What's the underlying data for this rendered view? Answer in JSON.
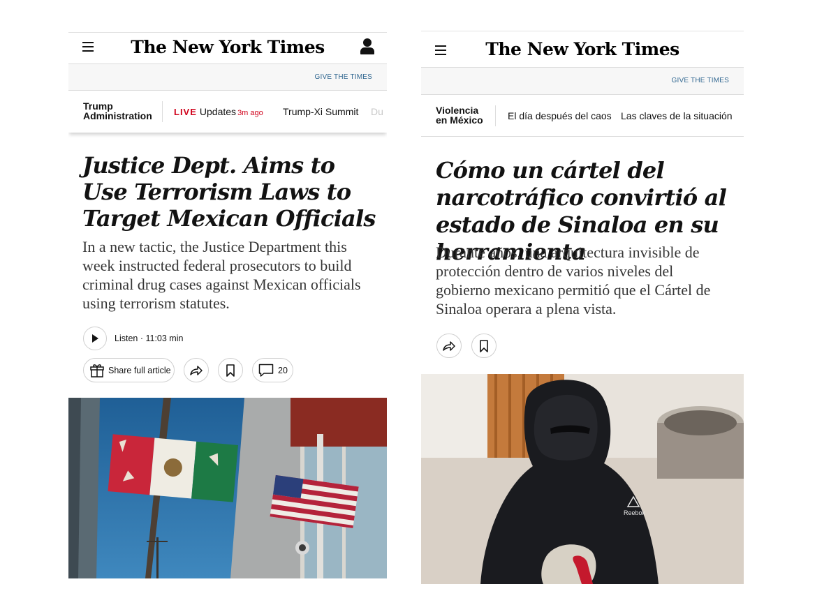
{
  "left": {
    "masthead": {
      "logo": "The New York Times",
      "menu_icon": "hamburger-icon",
      "account_icon": "user-icon"
    },
    "give_link": "GIVE THE TIMES",
    "nav": {
      "section": [
        "Trump",
        "Administration"
      ],
      "live": "LIVE",
      "updates": "Updates",
      "ago": "3m ago",
      "item2": "Trump-Xi Summit",
      "item3": "Du"
    },
    "headline": "Justice Dept. Aims to Use Terrorism Laws to Target Mexican Officials",
    "summary": "In a new tactic, the Justice Department this week instructed federal prosecutors to build criminal drug cases against Mexican officials using terrorism statutes.",
    "listen": "Listen · 11:03 min",
    "share_label": "Share full article",
    "comments_count": "20",
    "icons": [
      "play-icon",
      "gift-icon",
      "share-icon",
      "bookmark-icon",
      "comment-icon"
    ]
  },
  "right": {
    "masthead": {
      "logo": "The New York Times",
      "menu_icon": "hamburger-icon"
    },
    "give_link": "GIVE THE TIMES",
    "nav": {
      "section": [
        "Violencia",
        "en México"
      ],
      "item1": "El día después del caos",
      "item2": "Las claves de la situación"
    },
    "headline": "Cómo un cártel del narcotráfico convirtió al estado de Sinaloa en su herramienta",
    "summary": "Durante años, una arquitectura invisible de protección dentro de varios niveles del gobierno mexicano permitió que el Cártel de Sinaloa operara a plena vista.",
    "icons": [
      "share-icon",
      "bookmark-icon"
    ],
    "photo_logo": "Reebok"
  },
  "colors": {
    "live_red": "#d0021b",
    "link_blue": "#326891",
    "text": "#121212"
  }
}
